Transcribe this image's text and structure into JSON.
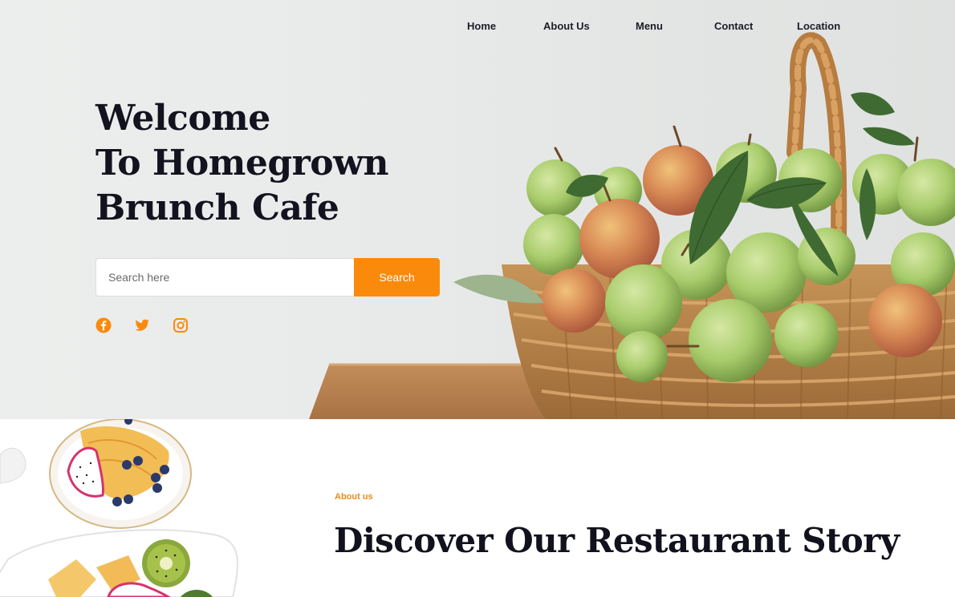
{
  "nav": {
    "items": [
      {
        "label": "Home"
      },
      {
        "label": "About Us"
      },
      {
        "label": "Menu"
      },
      {
        "label": "Contact"
      },
      {
        "label": "Location"
      }
    ]
  },
  "hero": {
    "title_lines": [
      "Welcome",
      "To Homegrown",
      "Brunch Cafe"
    ],
    "search": {
      "placeholder": "Search here",
      "value": "",
      "button_label": "Search"
    },
    "social": [
      {
        "icon": "facebook-icon"
      },
      {
        "icon": "twitter-icon"
      },
      {
        "icon": "instagram-icon"
      }
    ]
  },
  "about": {
    "eyebrow": "About us",
    "title": "Discover Our Restaurant Story"
  },
  "colors": {
    "accent": "#fa8a0c",
    "heading": "#13131f",
    "hero_background": "#e9ebea"
  }
}
